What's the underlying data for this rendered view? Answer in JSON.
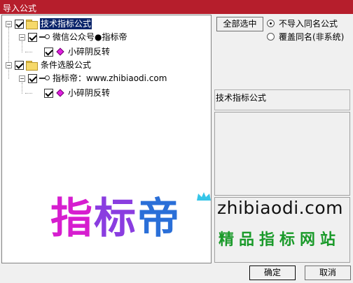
{
  "window": {
    "title": "导入公式"
  },
  "tree": {
    "nodes": [
      {
        "label": "技术指标公式",
        "level": 0,
        "type": "folder",
        "expanded": true,
        "checked": true,
        "selected": true
      },
      {
        "label": "微信公众号●指标帝",
        "level": 1,
        "type": "author",
        "expanded": true,
        "checked": true
      },
      {
        "label": "小碎阴反转",
        "level": 2,
        "type": "formula",
        "checked": true
      },
      {
        "label": "条件选股公式",
        "level": 0,
        "type": "folder",
        "expanded": true,
        "checked": true
      },
      {
        "label": "指标帝：www.zhibiaodi.com",
        "level": 1,
        "type": "author",
        "expanded": true,
        "checked": true
      },
      {
        "label": "小碎阴反转",
        "level": 2,
        "type": "formula",
        "checked": true
      }
    ]
  },
  "options": {
    "select_all_label": "全部选中",
    "radio_options": [
      {
        "label": "不导入同名公式",
        "selected": true
      },
      {
        "label": "覆盖同名(非系统)",
        "selected": false
      }
    ]
  },
  "info": {
    "category": "技术指标公式"
  },
  "watermark": {
    "logo_text": "指标帝",
    "site": "zhibiaodi.com",
    "tagline": "精品指标网站"
  },
  "buttons": {
    "ok_label": "确定",
    "cancel_label": "取消"
  },
  "colors": {
    "titlebar": "#b61e2c",
    "selection": "#0a246a",
    "tagline": "#1a9a2a"
  }
}
